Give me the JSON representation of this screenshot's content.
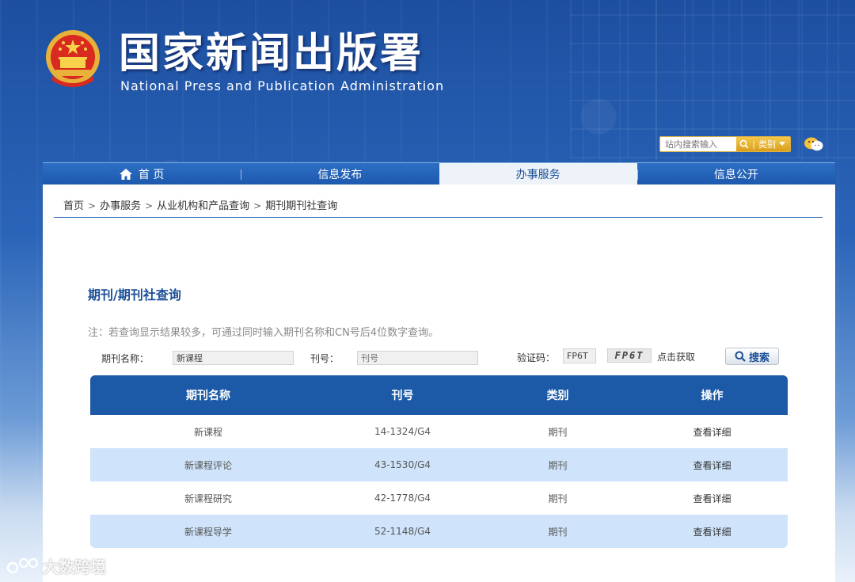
{
  "header": {
    "title": "国家新闻出版署",
    "subtitle": "National  Press and Publication Administration",
    "search_placeholder": "站内搜索输入",
    "search_category": "类别"
  },
  "nav": {
    "items": [
      {
        "label": "首 页",
        "icon": "home-icon"
      },
      {
        "label": "信息发布"
      },
      {
        "label": "办事服务",
        "active": true
      },
      {
        "label": "信息公开"
      }
    ]
  },
  "breadcrumb": [
    "首页",
    "办事服务",
    "从业机构和产品查询",
    "期刊期刊社查询"
  ],
  "breadcrumb_sep": ">",
  "page": {
    "heading": "期刊/期刊社查询",
    "note": "注：若查询显示结果较多，可通过同时输入期刊名称和CN号后4位数字查询。"
  },
  "form": {
    "name_label": "期刊名称：",
    "name_value": "新课程",
    "cn_label": "刊号：",
    "cn_placeholder": "刊号",
    "captcha_label": "验证码：",
    "captcha_value": "FP6T",
    "captcha_image_text": "FP6T",
    "captcha_refresh": "点击获取",
    "search_button": "搜索"
  },
  "table": {
    "headers": [
      "期刊名称",
      "刊号",
      "类别",
      "操作"
    ],
    "rows": [
      {
        "name": "新课程",
        "cn": "14-1324/G4",
        "type": "期刊",
        "action": "查看详细"
      },
      {
        "name": "新课程评论",
        "cn": "43-1530/G4",
        "type": "期刊",
        "action": "查看详细"
      },
      {
        "name": "新课程研究",
        "cn": "42-1778/G4",
        "type": "期刊",
        "action": "查看详细"
      },
      {
        "name": "新课程导学",
        "cn": "52-1148/G4",
        "type": "期刊",
        "action": "查看详细"
      }
    ]
  },
  "watermark": "大数跨境",
  "colors": {
    "primary_blue": "#1c5aa8",
    "accent_gold": "#e0b040",
    "row_alt": "#cfe4fb"
  }
}
